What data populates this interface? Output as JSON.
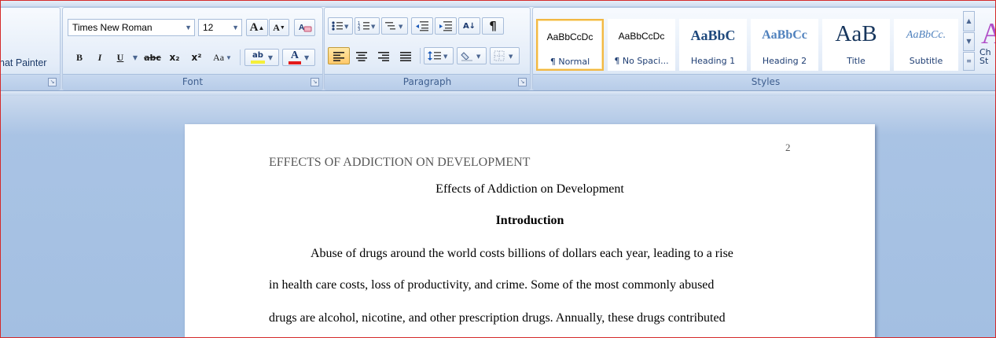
{
  "clipboard": {
    "format_painter_label": "nat Painter"
  },
  "font": {
    "group_label": "Font",
    "font_name": "Times New Roman",
    "font_size": "12",
    "bold": "B",
    "italic": "I",
    "underline": "U",
    "strikethrough": "abc",
    "subscript": "x₂",
    "superscript": "x²",
    "change_case": "Aa",
    "grow": "A",
    "shrink": "A",
    "highlight": "ab",
    "font_color": "A"
  },
  "paragraph": {
    "group_label": "Paragraph",
    "sort": "A↓",
    "show_marks": "¶"
  },
  "styles": {
    "group_label": "Styles",
    "items": [
      {
        "sample": "AaBbCcDc",
        "name": "¶ Normal"
      },
      {
        "sample": "AaBbCcDc",
        "name": "¶ No Spaci..."
      },
      {
        "sample": "AaBbC",
        "name": "Heading 1"
      },
      {
        "sample": "AaBbCc",
        "name": "Heading 2"
      },
      {
        "sample": "AaB",
        "name": "Title"
      },
      {
        "sample": "AaBbCc.",
        "name": "Subtitle"
      }
    ],
    "change_styles_label": "Ch St"
  },
  "document": {
    "header": "EFFECTS OF ADDICTION ON DEVELOPMENT",
    "page_number": "2",
    "title": "Effects of Addiction on Development",
    "heading": "Introduction",
    "lines": [
      "Abuse of drugs around the world costs billions of dollars each year, leading to a rise",
      "in health care costs, loss of productivity, and crime. Some of the most commonly abused",
      "drugs are alcohol, nicotine, and other prescription drugs.  Annually, these drugs contributed"
    ]
  },
  "colors": {
    "highlight": "#f5ef3a",
    "font_color": "#e21b1b",
    "selected_style_border": "#f2b844"
  }
}
